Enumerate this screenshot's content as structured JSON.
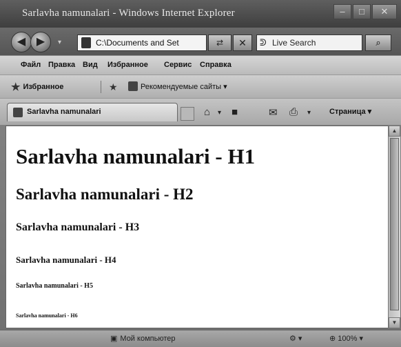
{
  "window": {
    "title": "Sarlavha namunalari - Windows Internet Explorer",
    "minimize": "–",
    "maximize": "□",
    "close": "✕"
  },
  "address_bar": {
    "back_glyph": "◀",
    "forward_glyph": "▶",
    "dropdown_glyph": "▾",
    "url": "C:\\Documents and Set",
    "refresh_glyph": "⇄",
    "stop_glyph": "✕",
    "search_placeholder": "Live Search",
    "search_glyph": "⌕"
  },
  "menu": {
    "items": [
      "Файл",
      "Правка",
      "Вид",
      "Избранное",
      "Сервис",
      "Справка"
    ]
  },
  "favorites_bar": {
    "favorites_label": "Избранное",
    "recommended_label": "Рекомендуемые сайты ▾"
  },
  "tabs": {
    "active_tab_label": "Sarlavha namunalari",
    "page_menu_label": "Страница ▾"
  },
  "content": {
    "h1": "Sarlavha namunalari - H1",
    "h2": "Sarlavha namunalari - H2",
    "h3": "Sarlavha namunalari - H3",
    "h4": "Sarlavha namunalari - H4",
    "h5": "Sarlavha namunalari - H5",
    "h6": "Sarlavha namunalari - H6"
  },
  "status_bar": {
    "zone_label": "Мой компьютер",
    "zoom": "100%"
  },
  "icons": {
    "back": "back-arrow-icon",
    "forward": "forward-arrow-icon",
    "search": "search-icon",
    "favorites": "star-icon",
    "home": "home-icon",
    "print": "printer-icon"
  }
}
